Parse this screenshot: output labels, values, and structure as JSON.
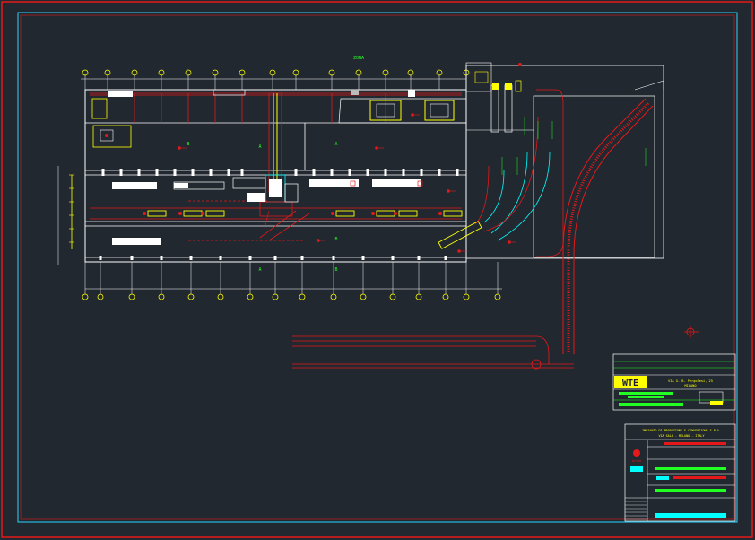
{
  "drawing": {
    "zone_label": "ZONA",
    "sections": [
      "A",
      "B",
      "A",
      "B",
      "A",
      "B"
    ],
    "colors": {
      "background": "#212830",
      "frame": "#e51919",
      "border_inner": "#2ad6ff",
      "walls": "#ffffff",
      "axes": "#ffff00",
      "process": "#ff2020",
      "highlight_green": "#22ff22",
      "cyan": "#00ffff"
    }
  },
  "title_block": {
    "logo": "WTE",
    "company_line_1": "VIA G. B. Pergolesi, 25",
    "company_line_2": "MILANO",
    "project_title": "IMPIANTO DI PRODUZIONE E CONVERSIONE S.P.A.",
    "project_location": "VIA SALA - MILANO - ITALY",
    "client_label": "Arvea"
  }
}
